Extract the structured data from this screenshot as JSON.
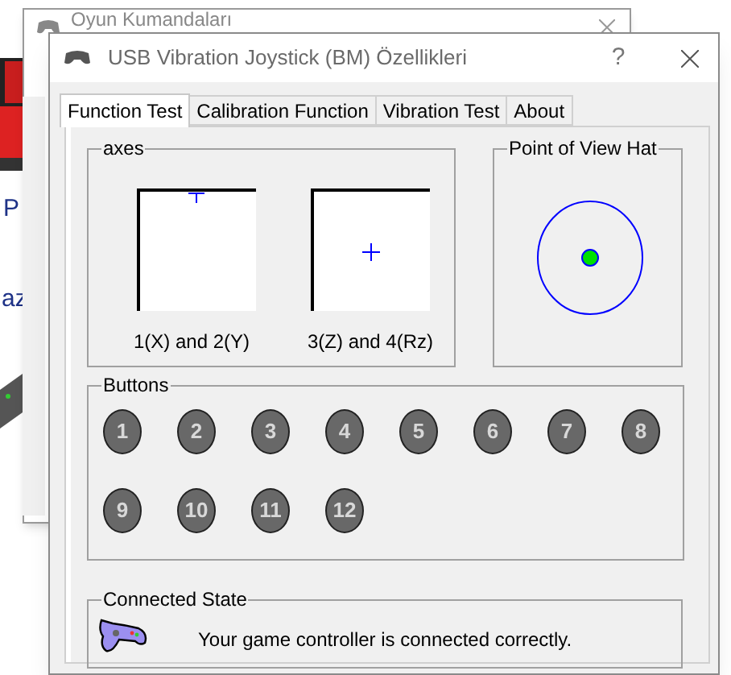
{
  "background_window": {
    "labels": [
      "P",
      "az"
    ]
  },
  "middle_window": {
    "title": "Oyun Kumandaları"
  },
  "dialog": {
    "title": "USB Vibration Joystick (BM) Özellikleri",
    "help": "?"
  },
  "tabs": [
    {
      "label": "Function Test",
      "selected": true
    },
    {
      "label": "Calibration Function",
      "selected": false
    },
    {
      "label": "Vibration Test",
      "selected": false
    },
    {
      "label": "About",
      "selected": false
    }
  ],
  "axes": {
    "title": "axes",
    "plots": [
      {
        "label": "1(X) and 2(Y)"
      },
      {
        "label": "3(Z) and 4(Rz)"
      }
    ]
  },
  "pov_hat": {
    "title": "Point of View Hat"
  },
  "buttons": {
    "title": "Buttons",
    "items": [
      "1",
      "2",
      "3",
      "4",
      "5",
      "6",
      "7",
      "8",
      "9",
      "10",
      "11",
      "12"
    ]
  },
  "connected_state": {
    "title": "Connected State",
    "message": "Your game controller is connected correctly."
  }
}
